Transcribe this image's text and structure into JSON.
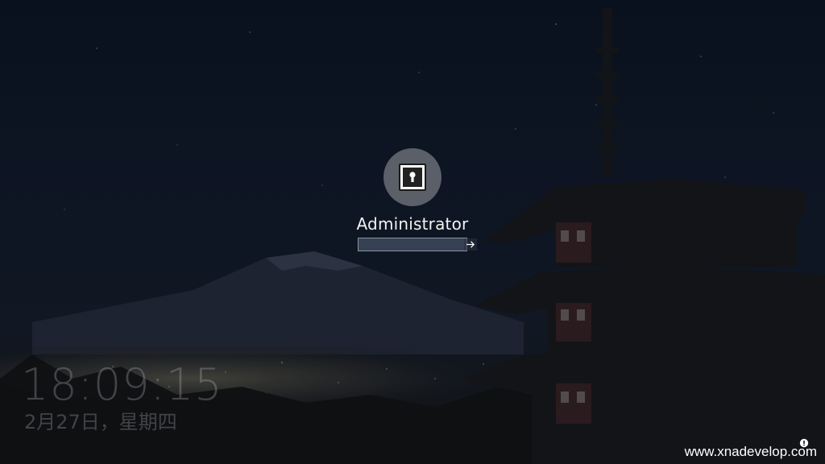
{
  "login": {
    "username": "Administrator",
    "password_value": "",
    "password_placeholder": "",
    "submit_icon": "arrow-right-icon",
    "avatar_icon": "keyhole-lock-icon"
  },
  "lockscreen": {
    "time": "18:09:15",
    "date": "2月27日，星期四"
  },
  "watermark": "www.xnadevelop.com",
  "tray": {
    "network_icon": "network-status-icon"
  },
  "colors": {
    "avatar_bg": "#5a5f68",
    "text": "#f2f2f2",
    "input_border": "#8a93a0",
    "input_bg": "#3f4a5c"
  }
}
